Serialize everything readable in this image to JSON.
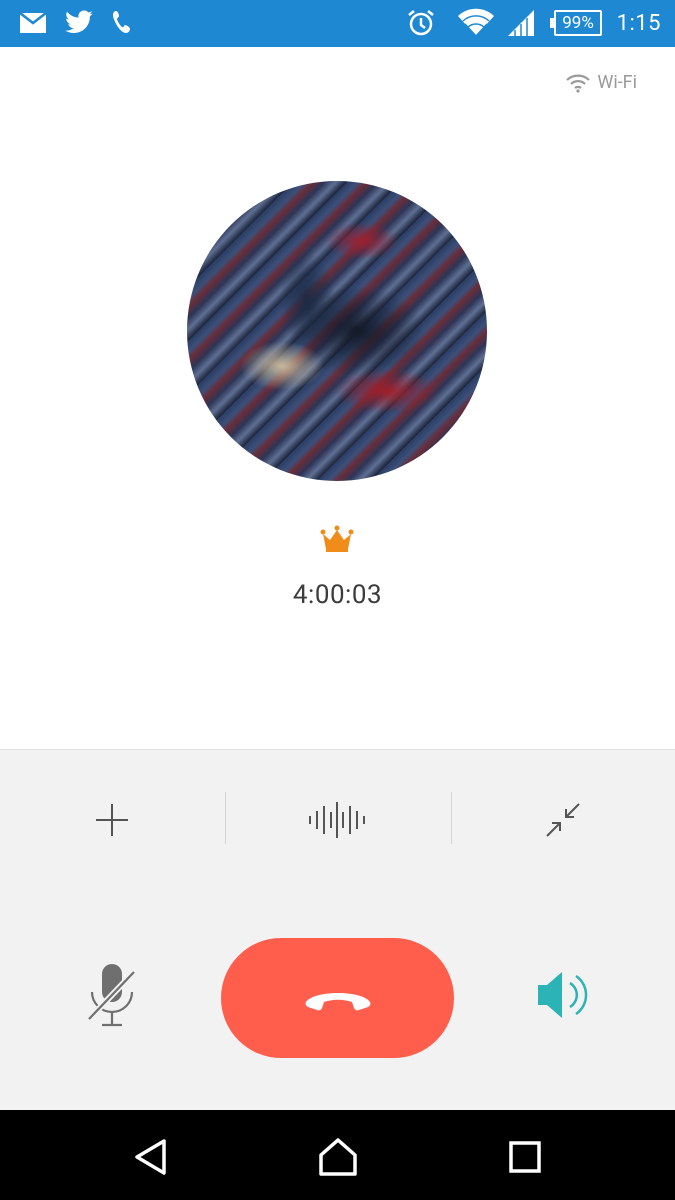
{
  "status_bar": {
    "time": "1:15",
    "battery": "99%",
    "icons": [
      "mail-icon",
      "twitter-icon",
      "phone-icon",
      "alarm-icon",
      "wifi-icon",
      "signal-icon",
      "battery-icon"
    ]
  },
  "call": {
    "network_label": "Wi-Fi",
    "duration": "4:00:03"
  },
  "controls": {
    "top_row": [
      "add-icon",
      "voice-waveform-icon",
      "minimize-icon"
    ],
    "bottom_row": [
      "mute-mic-icon",
      "end-call-icon",
      "speaker-icon"
    ]
  },
  "nav": {
    "buttons": [
      "back-icon",
      "home-icon",
      "recents-icon"
    ]
  },
  "colors": {
    "status_bar": "#1e88d2",
    "end_call": "#ff5e4d",
    "crown": "#f08c1a",
    "speaker": "#2bb3b5",
    "panel": "#f2f2f2"
  }
}
